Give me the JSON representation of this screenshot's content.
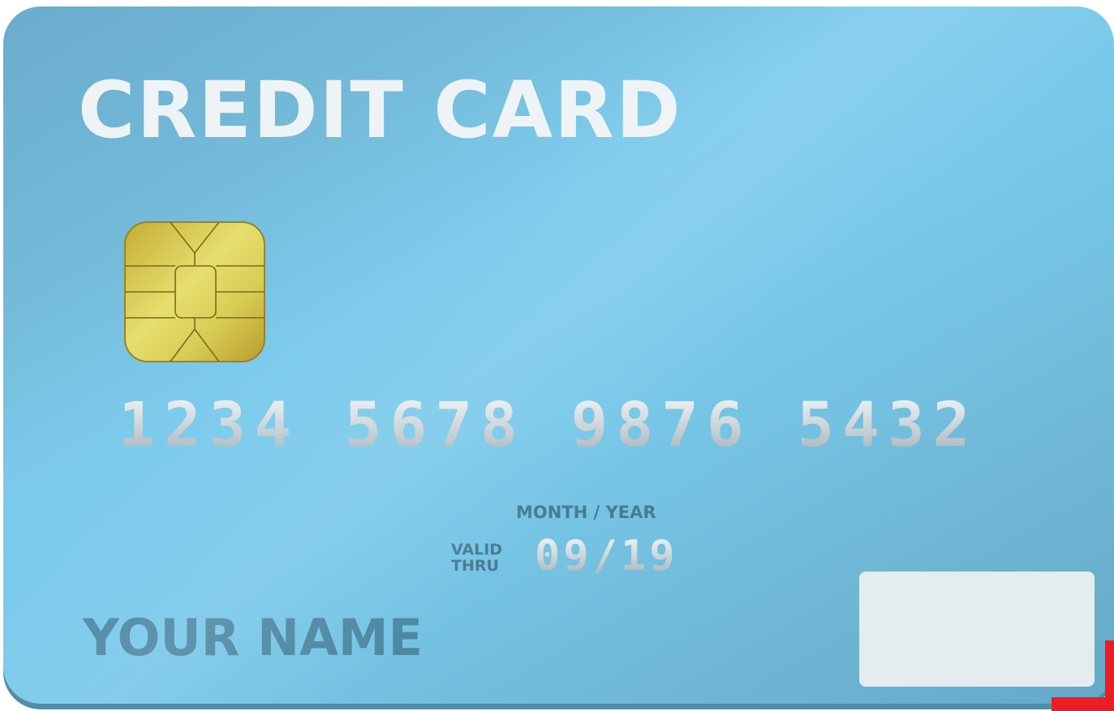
{
  "card": {
    "title": "CREDIT CARD",
    "number": "1234 5678 9876 5432",
    "expiry_caption": "MONTH / YEAR",
    "valid_line1": "VALID",
    "valid_line2": "THRU",
    "expiry": "09/19",
    "holder_name": "YOUR NAME",
    "colors": {
      "card_base": "#79c9ea",
      "title_text": "#eef3f5",
      "name_text": "#4d88a3",
      "chip_gold": "#d4c54a",
      "panel": "#e4ecf0",
      "corner_mark": "#ee1c24"
    },
    "icons": {
      "chip": "emv-chip-icon"
    }
  }
}
